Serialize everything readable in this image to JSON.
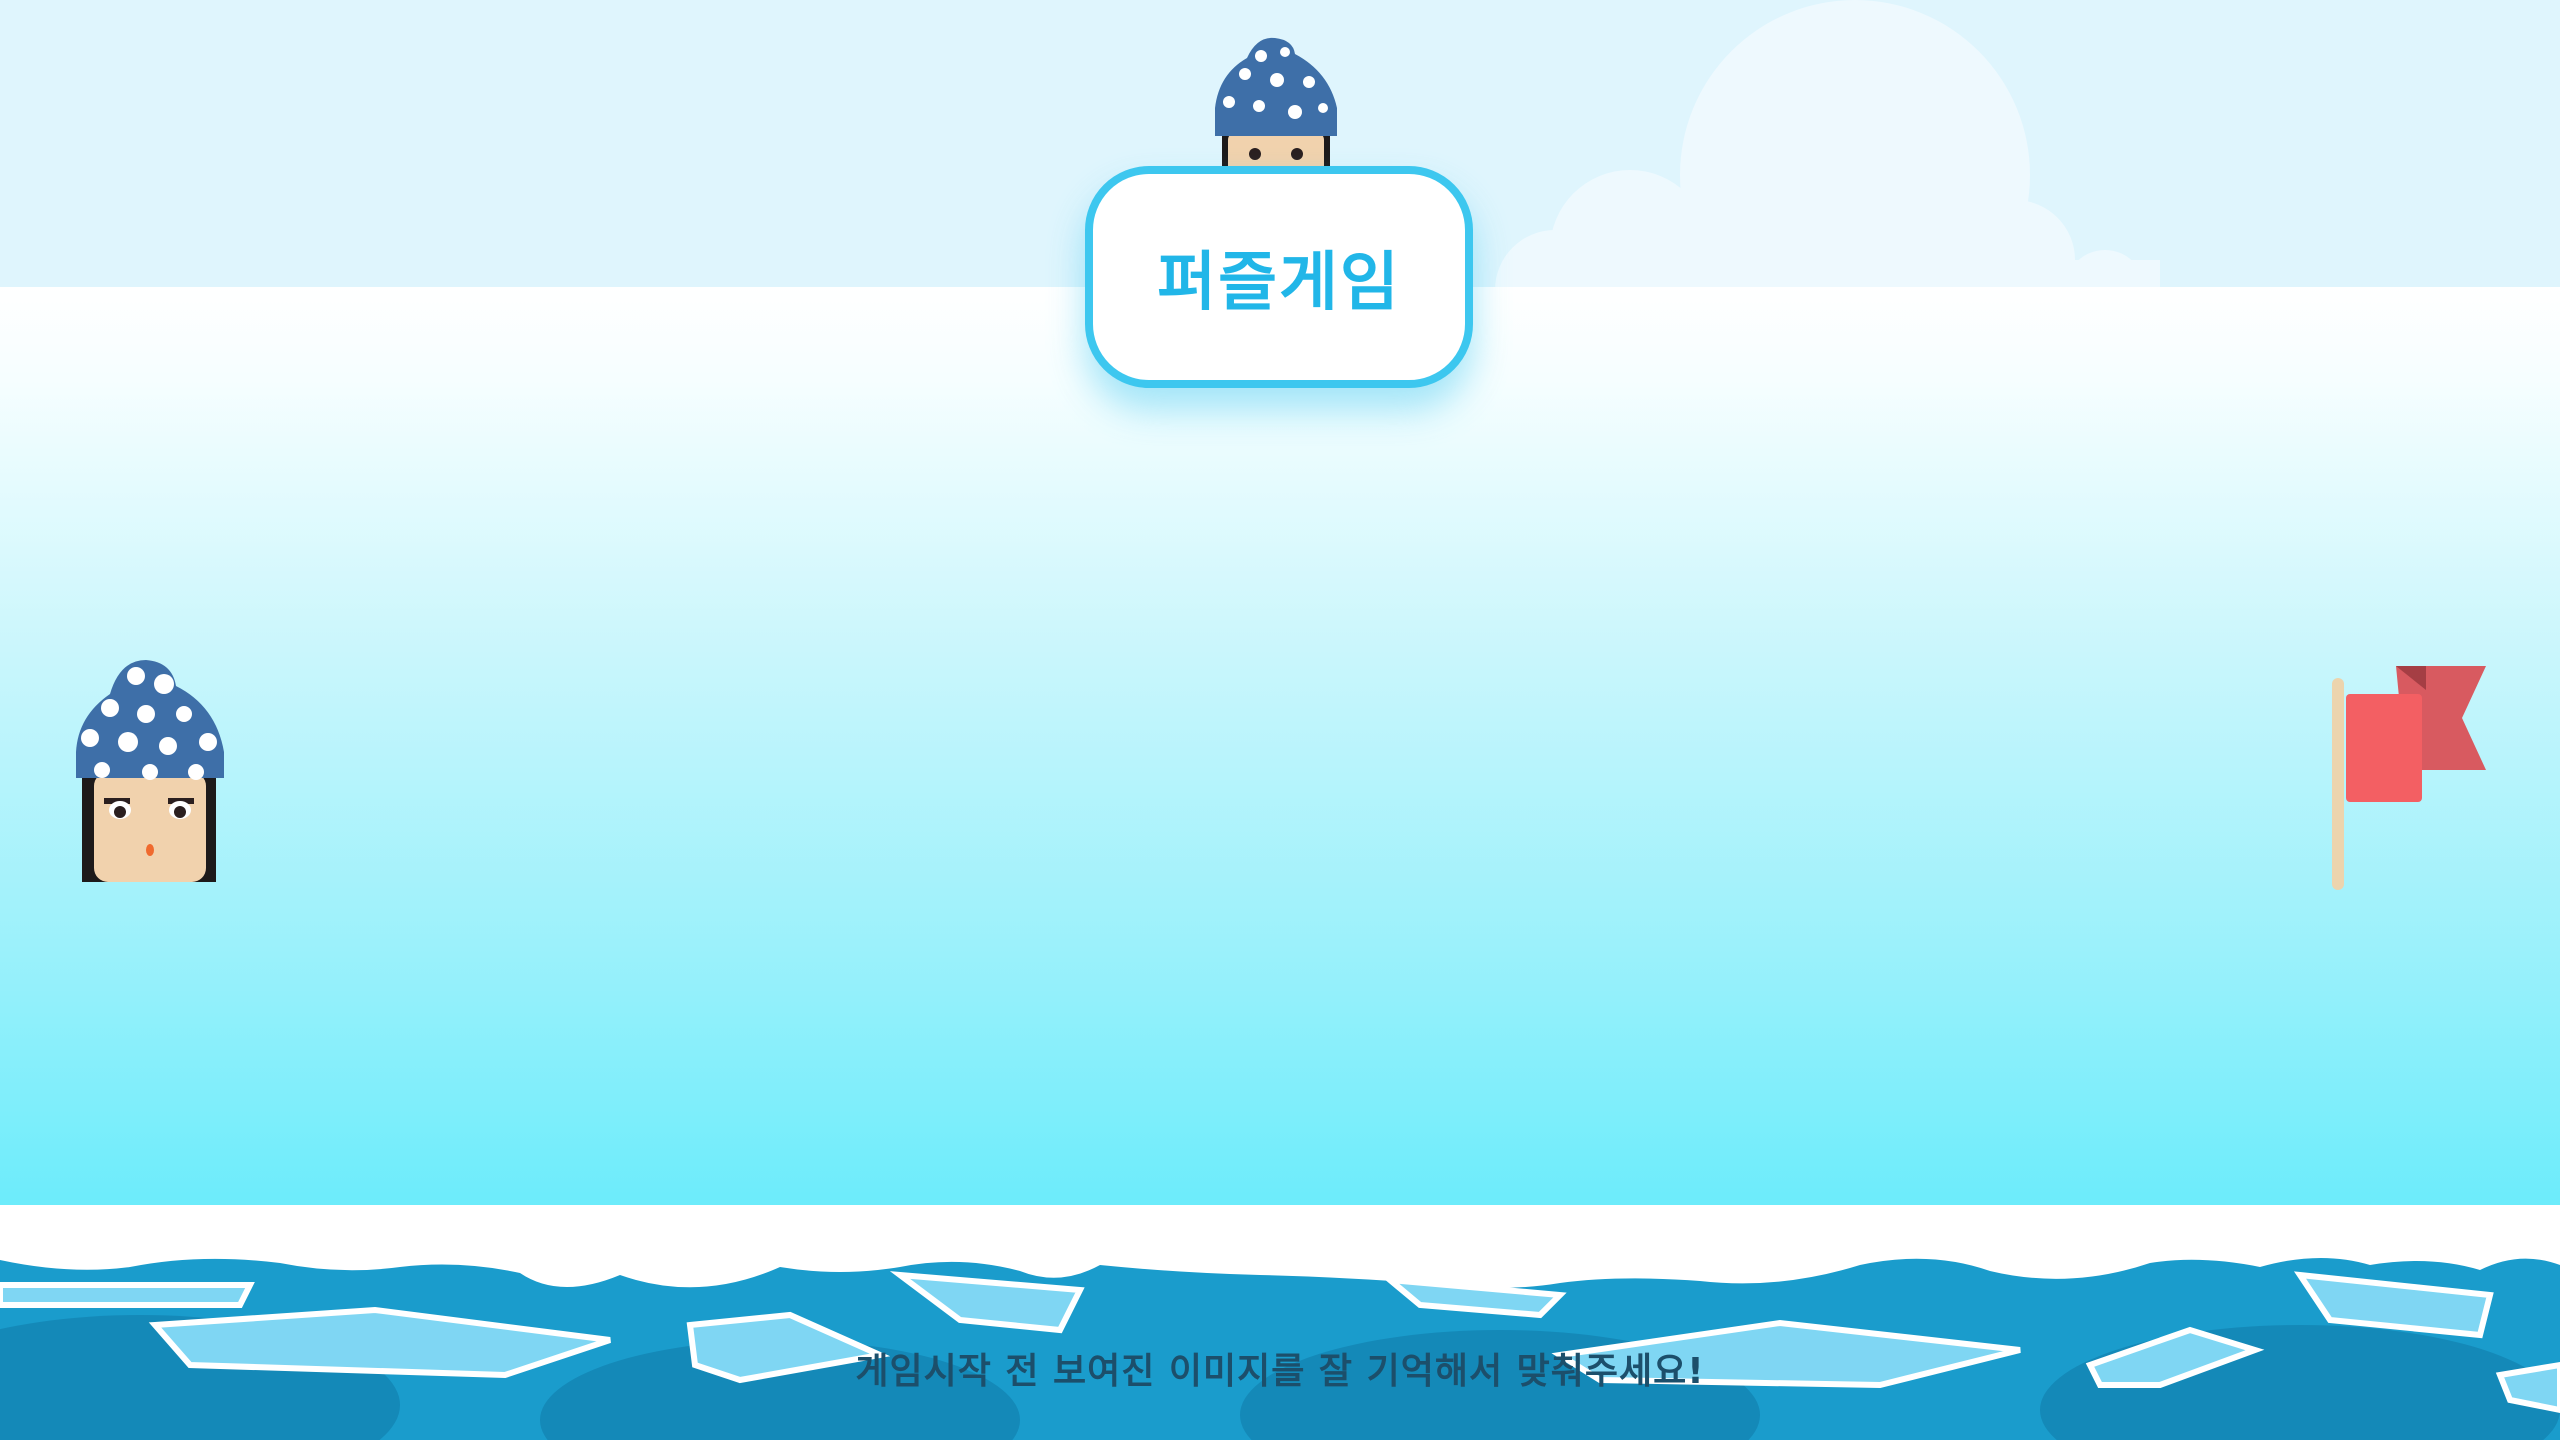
{
  "game": {
    "title": "퍼즐게임",
    "hint": "게임시작 전 보여진 이미지를 잘 기억해서 맞춰주세요!"
  },
  "sprites": {
    "player_icon": "character-head-icon",
    "goal_icon": "red-flag-icon",
    "title_peek_icon": "character-peeking-icon"
  },
  "colors": {
    "title_border": "#3dc7ef",
    "title_text": "#21b6e8",
    "hat": "#3e6fa8",
    "skin": "#f1d2ad",
    "flag": "#f35f63",
    "water": "#1a9ccc",
    "ice": "#7fd6f3",
    "hint_text": "#1c4f6b"
  }
}
